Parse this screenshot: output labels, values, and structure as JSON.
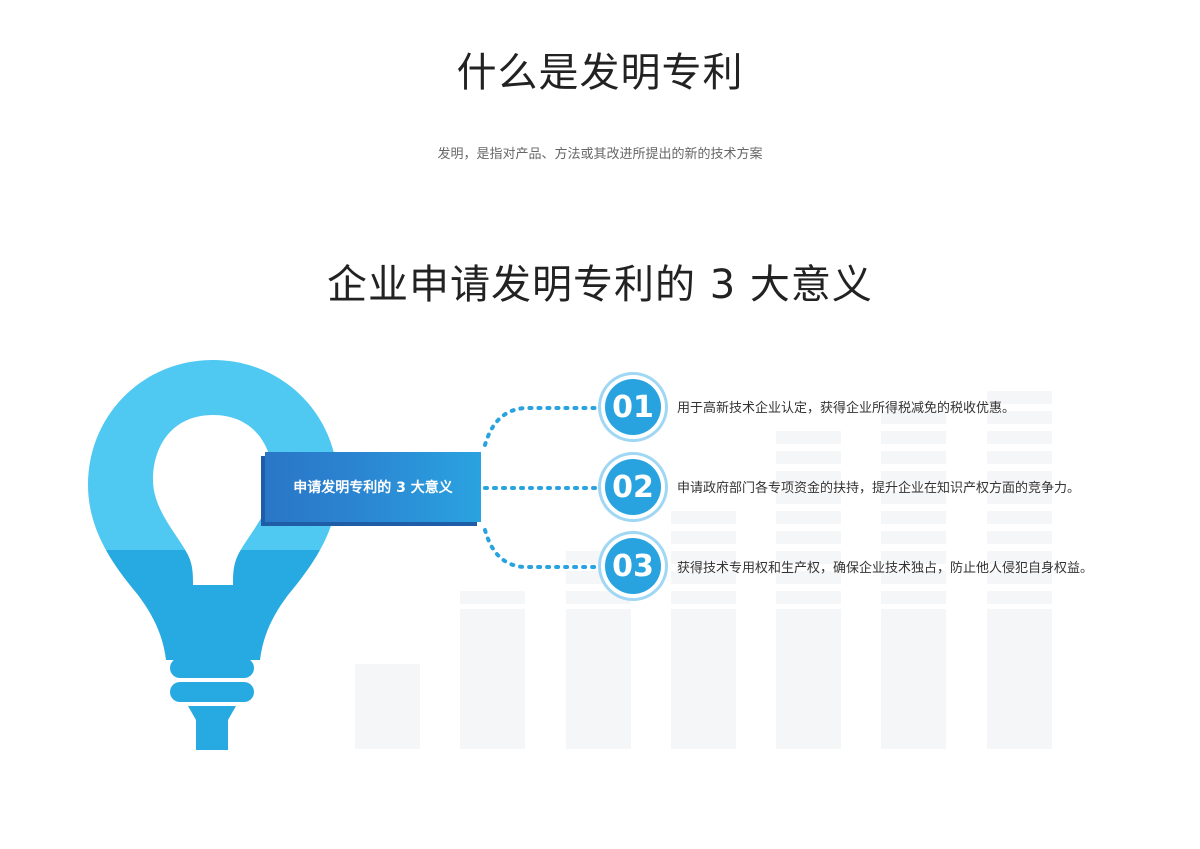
{
  "page": {
    "title": "什么是发明专利",
    "subtitle": "发明，是指对产品、方法或其改进所提出的新的技术方案",
    "heading": "企业申请发明专利的 3 大意义"
  },
  "diagram": {
    "center_label": "申请发明专利的 3 大意义",
    "items": [
      {
        "number": "01",
        "text": "用于高新技术企业认定，获得企业所得税减免的税收优惠。"
      },
      {
        "number": "02",
        "text": "申请政府部门各专项资金的扶持，提升企业在知识产权方面的竞争力。"
      },
      {
        "number": "03",
        "text": "获得技术专用权和生产权，确保企业技术独占，防止他人侵犯自身权益。"
      }
    ]
  },
  "colors": {
    "accent": "#29a3e0",
    "bulb_light": "#4fc8f2",
    "bulb_dark": "#27a9e1",
    "label_dark": "#2a76c7",
    "text": "#333333",
    "background_bars": "#f5f6f8"
  },
  "icons": [
    "lightbulb-icon"
  ]
}
